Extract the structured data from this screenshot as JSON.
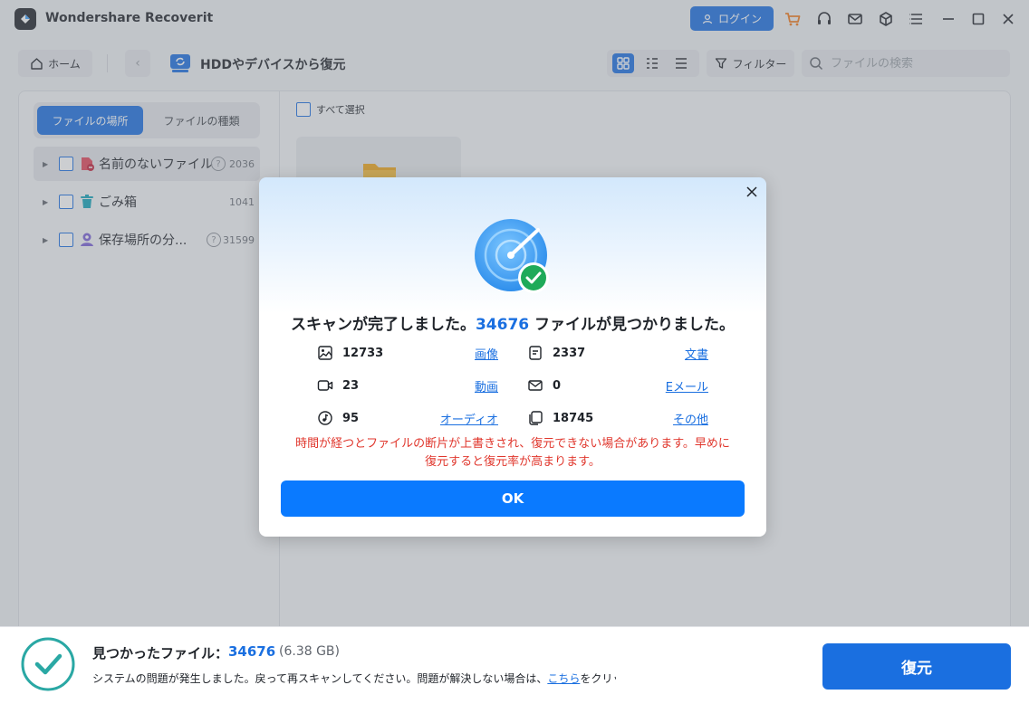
{
  "app": {
    "title": "Wondershare Recoverit",
    "login_label": "ログイン"
  },
  "toolbar": {
    "home_label": "ホーム",
    "page_title": "HDDやデバイスから復元",
    "filter_label": "フィルター",
    "search_placeholder": "ファイルの検索"
  },
  "sidebar": {
    "tabs": [
      {
        "label": "ファイルの場所"
      },
      {
        "label": "ファイルの種類"
      }
    ],
    "items": [
      {
        "label": "名前のないファイル",
        "count": "2036",
        "has_help": true,
        "icon": "unnamed-file-icon"
      },
      {
        "label": "ごみ箱",
        "count": "1041",
        "has_help": false,
        "icon": "trash-icon"
      },
      {
        "label": "保存場所の分...",
        "count": "31599",
        "has_help": true,
        "icon": "lost-location-icon"
      }
    ]
  },
  "content": {
    "select_all_label": "すべて選択"
  },
  "modal": {
    "heading_pre": "スキャンが完了しました。",
    "heading_count": "34676",
    "heading_post": " ファイルが見つかりました。",
    "stats": [
      {
        "icon": "image-icon",
        "value": "12733",
        "label": "画像"
      },
      {
        "icon": "document-icon",
        "value": "2337",
        "label": "文書"
      },
      {
        "icon": "video-icon",
        "value": "23",
        "label": "動画"
      },
      {
        "icon": "email-icon",
        "value": "0",
        "label": "Eメール"
      },
      {
        "icon": "audio-icon",
        "value": "95",
        "label": "オーディオ"
      },
      {
        "icon": "other-icon",
        "value": "18745",
        "label": "その他"
      }
    ],
    "warning_line1": "時間が経つとファイルの断片が上書きされ、復元できない場合があります。早めに",
    "warning_line2": "復元すると復元率が高まります。",
    "ok_label": "OK"
  },
  "bottom": {
    "found_label": "見つかったファイル：",
    "found_count": "34676",
    "found_size": "(6.38 GB)",
    "msg_pre": "システムの問題が発生しました。戻って再スキャンしてください。問題が解決しない場合は、",
    "msg_link": "こちら",
    "msg_post": "をクリックして",
    "recover_label": "復元"
  },
  "colors": {
    "accent": "#1a6fe0",
    "ok_button": "#0a7aff",
    "warning": "#e0362c",
    "success": "#1faa59"
  }
}
